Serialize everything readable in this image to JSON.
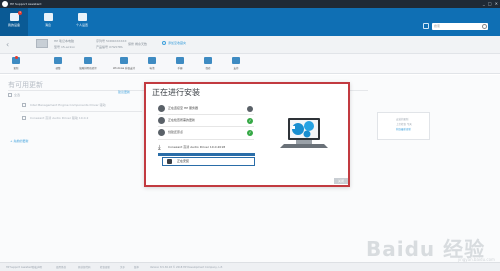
{
  "titlebar": {
    "title": "HP Support Assistant",
    "controls": [
      "_",
      "□",
      "✕"
    ]
  },
  "nav": {
    "tabs": [
      {
        "label": "我的设备",
        "badge": "1"
      },
      {
        "label": "消息"
      },
      {
        "label": "个人设置"
      }
    ],
    "search_placeholder": "搜索"
  },
  "product": {
    "name": "HP 笔记本电脑",
    "model": "型号 15-ac1xx",
    "serial": "序列号 5CD6XXXXXX",
    "product_no": "产品编号 X7G57PA",
    "warranty": "保修 剩余天数",
    "favorite": "添加至收藏夹"
  },
  "toolbar": {
    "items": [
      {
        "label": "更新",
        "badge": true
      },
      {
        "label": "调整"
      },
      {
        "label": "故障排除和修复"
      },
      {
        "label": "Windows 升级支持"
      },
      {
        "label": "电池"
      },
      {
        "label": "手册"
      },
      {
        "label": "保修"
      },
      {
        "label": "支持"
      }
    ]
  },
  "content": {
    "heading": "有可用更新",
    "select_all": "全选",
    "recommended": "建议更新",
    "updates": [
      {
        "name": "Intel Management Engine Components Driver 驱动"
      },
      {
        "name": "Conexant 高清 Audio Driver 驱动 10.0.2"
      }
    ],
    "history": "+ 先前的更新",
    "sidecard": {
      "line1": "安装的更新",
      "line2": "上次检查 今天",
      "line3": "获取最新更新"
    }
  },
  "dialog": {
    "title": "正在进行安装",
    "steps": [
      {
        "label": "正在连接至 HP 服务器",
        "status": "busy",
        "icon": "globe-icon"
      },
      {
        "label": "正在检查所需的更新",
        "status": "done",
        "icon": "magnifier-icon"
      },
      {
        "label": "创建还原点",
        "status": "done",
        "icon": "restore-icon"
      }
    ],
    "download_label": "Conexant 高清 Audio Driver 10.0.2018",
    "install_label": "正在安装",
    "close_label": "关闭",
    "progress": 1.0
  },
  "footer": {
    "links": [
      "HP Support Assistant",
      "隐私声明",
      "使用条款",
      "开放源代码",
      "检查更新",
      "关于",
      "版本"
    ],
    "version": "Version 8.5.36.18  © 2018 HP Development Company, L.P."
  },
  "watermark": {
    "text": "Baidu 经验",
    "sub": "jingyan.baidu.com"
  }
}
